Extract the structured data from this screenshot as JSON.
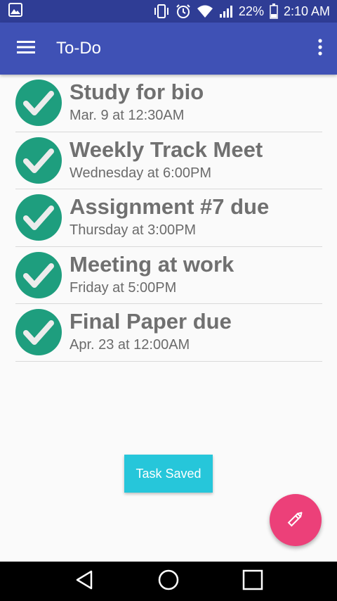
{
  "status_bar": {
    "battery_percent": "22%",
    "time": "2:10 AM",
    "icons": [
      "image-icon",
      "vibrate-icon",
      "alarm-icon",
      "wifi-icon",
      "signal-icon",
      "battery-icon"
    ]
  },
  "app_bar": {
    "title": "To-Do",
    "menu_icon": "hamburger-menu-icon",
    "overflow_icon": "more-vert-icon"
  },
  "tasks": [
    {
      "title": "Study for bio",
      "time": "Mar. 9 at 12:30AM",
      "checked": true
    },
    {
      "title": "Weekly Track Meet",
      "time": "Wednesday at 6:00PM",
      "checked": true
    },
    {
      "title": "Assignment #7 due",
      "time": "Thursday at 3:00PM",
      "checked": true
    },
    {
      "title": "Meeting at work",
      "time": "Friday at 5:00PM",
      "checked": true
    },
    {
      "title": "Final Paper due",
      "time": "Apr. 23 at 12:00AM",
      "checked": true
    }
  ],
  "toast": {
    "text": "Task Saved"
  },
  "fab": {
    "icon": "pencil-icon"
  },
  "colors": {
    "status_bar": "#2f3d95",
    "app_bar": "#3f51b5",
    "check_circle": "#1e9e7e",
    "toast": "#26c6da",
    "fab": "#ec4079"
  }
}
